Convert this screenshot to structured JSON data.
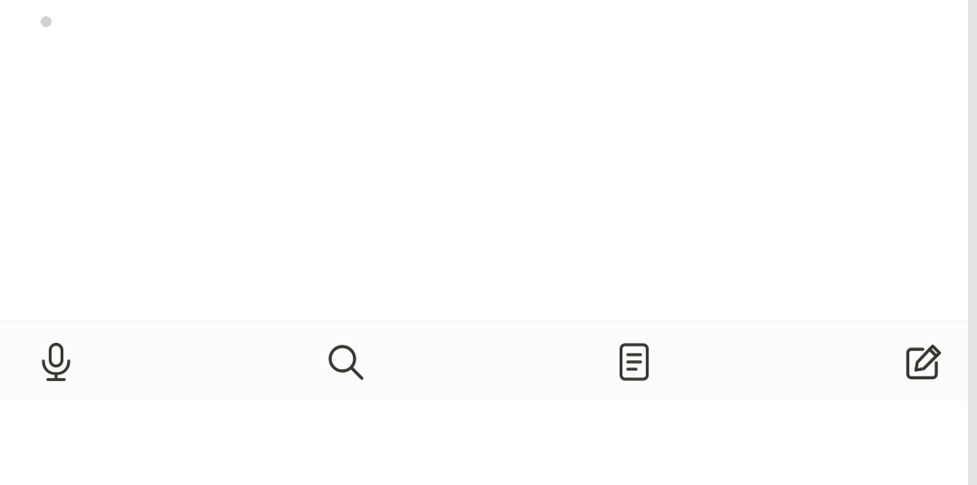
{
  "content": {
    "bullet_color": "#d2d2d2"
  },
  "toolbar": {
    "icon_color": "#3a3631",
    "buttons": [
      {
        "id": "mic",
        "icon": "microphone-icon"
      },
      {
        "id": "search",
        "icon": "search-icon"
      },
      {
        "id": "notes",
        "icon": "document-icon"
      },
      {
        "id": "compose",
        "icon": "edit-pencil-icon"
      }
    ]
  }
}
